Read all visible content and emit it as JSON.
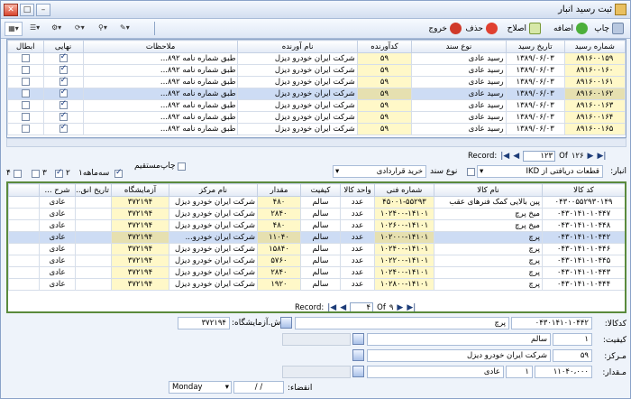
{
  "window": {
    "title": "ثبت رسید انبار"
  },
  "toolbar": {
    "print": "چاپ",
    "add": "اضافه",
    "edit": "اصلاح",
    "delete": "حذف",
    "exit": "خروج"
  },
  "top_grid": {
    "columns": [
      "شماره رسید",
      "تاریخ رسید",
      "نوع سند",
      "کدآورنده",
      "نام آورنده",
      "ملاحظات",
      "نهایی",
      "ابطال"
    ],
    "rows": [
      [
        "۸۹۱۶۰۰۱۵۹",
        "۱۳۸۹/۰۶/۰۳",
        "رسید عادی",
        "۵۹",
        "شرکت ایران خودرو دیزل",
        "طبق شماره نامه ۸۹۲...",
        "on",
        "off"
      ],
      [
        "۸۹۱۶۰۰۱۶۰",
        "۱۳۸۹/۰۶/۰۳",
        "رسید عادی",
        "۵۹",
        "شرکت ایران خودرو دیزل",
        "طبق شماره نامه ۸۹۲...",
        "on",
        "off"
      ],
      [
        "۸۹۱۶۰۰۱۶۱",
        "۱۳۸۹/۰۶/۰۳",
        "رسید عادی",
        "۵۹",
        "شرکت ایران خودرو دیزل",
        "طبق شماره نامه ۸۹۲...",
        "on",
        "off"
      ],
      [
        "۸۹۱۶۰۰۱۶۲",
        "۱۳۸۹/۰۶/۰۳",
        "رسید عادی",
        "۵۹",
        "شرکت ایران خودرو دیزل",
        "طبق شماره نامه ۸۹۲...",
        "on",
        "off"
      ],
      [
        "۸۹۱۶۰۰۱۶۳",
        "۱۳۸۹/۰۶/۰۳",
        "رسید عادی",
        "۵۹",
        "شرکت ایران خودرو دیزل",
        "طبق شماره نامه ۸۹۲...",
        "on",
        "off"
      ],
      [
        "۸۹۱۶۰۰۱۶۴",
        "۱۳۸۹/۰۶/۰۳",
        "رسید عادی",
        "۵۹",
        "شرکت ایران خودرو دیزل",
        "طبق شماره نامه ۸۹۲...",
        "on",
        "off"
      ],
      [
        "۸۹۱۶۰۰۱۶۵",
        "۱۳۸۹/۰۶/۰۳",
        "رسید عادی",
        "۵۹",
        "شرکت ایران خودرو دیزل",
        "طبق شماره نامه ۸۹۲...",
        "on",
        "off"
      ]
    ]
  },
  "top_pager": {
    "record_label": "Record:",
    "current": "۱۲۳",
    "of": "Of",
    "total": "۱۲۶"
  },
  "filter": {
    "warehouse_label": "انبار:",
    "warehouse_value": "قطعات دریافتی از IKD",
    "doc_type_label": "نوع سند",
    "doc_type_value": "خرید قراردادی",
    "direct_print": "چاپ‌مستقیم",
    "options": [
      "سه‌ماهه۱",
      "۲",
      "۳",
      "۴"
    ]
  },
  "bottom_grid": {
    "columns": [
      "کد کالا",
      "نام کالا",
      "شماره فنی",
      "واحد کالا",
      "کیفیت",
      "مقدار",
      "نام مرکز",
      "آزمایشگاه",
      "تاریخ انق...",
      "شرح ..."
    ],
    "rows": [
      [
        "۰۴۳۰۰۵۵۲۹۳۰۱۴۹",
        "پین بالایی کمک فنرهای عقب",
        "۴۵۰۰۱-۵۵۲۹۳",
        "عدد",
        "سالم",
        "۴۸۰",
        "شرکت ایران خودرو دیزل",
        "۳۷۲۱۹۴",
        "",
        "عادی"
      ],
      [
        "۰۴۳۰۱۴۱۰۱۰۴۴۷",
        "میخ پرچ",
        "۱۰۲۴۰۰-۱۴۱۰۱",
        "عدد",
        "سالم",
        "۲۸۴۰",
        "شرکت ایران خودرو دیزل",
        "۳۷۲۱۹۴",
        "",
        "عادی"
      ],
      [
        "۰۴۳۰۱۴۱۰۱۰۴۴۸",
        "میخ پرچ",
        "۱۰۲۶۰۰-۱۴۱۰۱",
        "عدد",
        "سالم",
        "۴۸۰",
        "شرکت ایران خودرو دیزل",
        "۳۷۲۱۹۴",
        "",
        "عادی"
      ],
      [
        "۰۴۳۰۱۴۱۰۱۰۴۴۲",
        "پرچ",
        "۱۰۲۰۰۰-۱۴۱۰۱",
        "عدد",
        "سالم",
        "۱۱۰۴۰",
        "شرکت ایران خودرو...",
        "۳۷۲۱۹۴",
        "",
        "عادی"
      ],
      [
        "۰۴۳۰۱۴۱۰۱۰۴۴۶",
        "پرچ",
        "۱۰۲۴۰۰-۱۴۱۰۱",
        "عدد",
        "سالم",
        "۱۵۸۴۰",
        "شرکت ایران خودرو دیزل",
        "۳۷۲۱۹۴",
        "",
        "عادی"
      ],
      [
        "۰۴۳۰۱۴۱۰۱۰۴۴۵",
        "پرچ",
        "۱۰۲۲۰۰-۱۴۱۰۱",
        "عدد",
        "سالم",
        "۵۷۶۰",
        "شرکت ایران خودرو دیزل",
        "۳۷۲۱۹۴",
        "",
        "عادی"
      ],
      [
        "۰۴۳۰۱۴۱۰۱۰۴۴۳",
        "پرچ",
        "۱۰۲۴۰۰-۱۴۱۰۱",
        "عدد",
        "سالم",
        "۲۸۴۰",
        "شرکت ایران خودرو دیزل",
        "۳۷۲۱۹۴",
        "",
        "عادی"
      ],
      [
        "۰۴۳۰۱۴۱۰۱۰۴۴۴",
        "پرچ",
        "۱۰۲۸۰۰-۱۴۱۰۱",
        "عدد",
        "سالم",
        "۱۹۲۰",
        "شرکت ایران خودرو دیزل",
        "۳۷۲۱۹۴",
        "",
        "عادی"
      ]
    ]
  },
  "bottom_pager": {
    "record_label": "Record:",
    "current": "۴",
    "of": "Of",
    "total": "۹"
  },
  "detail": {
    "code_label": "کدکالا:",
    "code_value": "۰۴۳۰۱۴۱۰۱۰۴۴۲",
    "name_value": "پرچ",
    "lab_label": "ش.آزمایشگاه:",
    "lab_value": "۳۷۲۱۹۴",
    "quality_label": "کیفیت:",
    "quality_code": "۱",
    "quality_value": "سالم",
    "center_label": "مـرکز:",
    "center_code": "۵۹",
    "center_value": "شرکت ایران خودرو دیزل",
    "qty_label": "مـقدار:",
    "qty_value": "۱۱۰۴۰،۰۰۰",
    "unit_code": "۱",
    "unit_value": "عادی",
    "expiry_label": "انقضاء:",
    "date_value": "/   /",
    "day_value": "Monday"
  },
  "colors": {
    "accent": "#1d3c78",
    "highlight": "#fff8c8",
    "selected": "#cddcf4",
    "green_border": "#5a8a3c"
  }
}
